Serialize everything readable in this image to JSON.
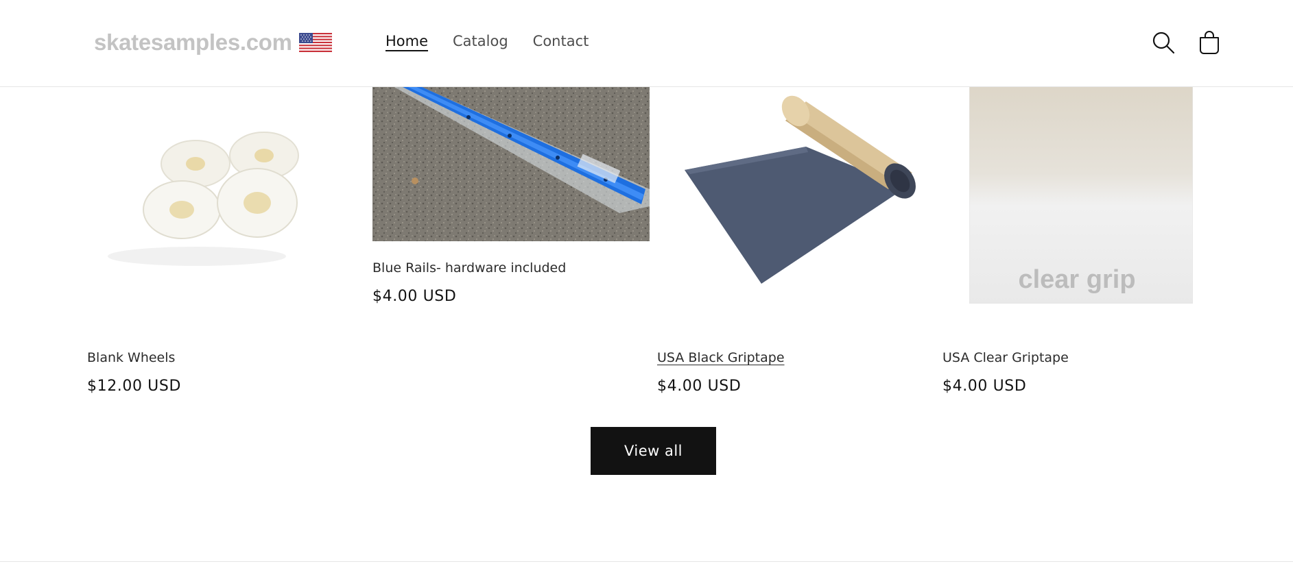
{
  "header": {
    "logo_text": "skatesamples.com",
    "nav": [
      {
        "label": "Home",
        "active": true
      },
      {
        "label": "Catalog",
        "active": false
      },
      {
        "label": "Contact",
        "active": false
      }
    ],
    "icons": [
      "search-icon",
      "cart-icon"
    ]
  },
  "products": [
    {
      "title": "Blank Wheels",
      "price": "$12.00 USD",
      "image": "white-skateboard-wheels"
    },
    {
      "title": "Blue Rails- hardware included",
      "price": "$4.00 USD",
      "image": "blue-rails-on-concrete"
    },
    {
      "title": "USA Black Griptape",
      "price": "$4.00 USD",
      "image": "black-griptape-roll"
    },
    {
      "title": "USA Clear Griptape",
      "price": "$4.00 USD",
      "image": "clear-griptape-sheet",
      "image_text": "clear grip"
    }
  ],
  "view_all_label": "View all",
  "colors": {
    "text": "#121212",
    "button_bg": "#121212",
    "logo_gray": "#c3c3c3",
    "rail_blue": "#1e6fe0"
  }
}
